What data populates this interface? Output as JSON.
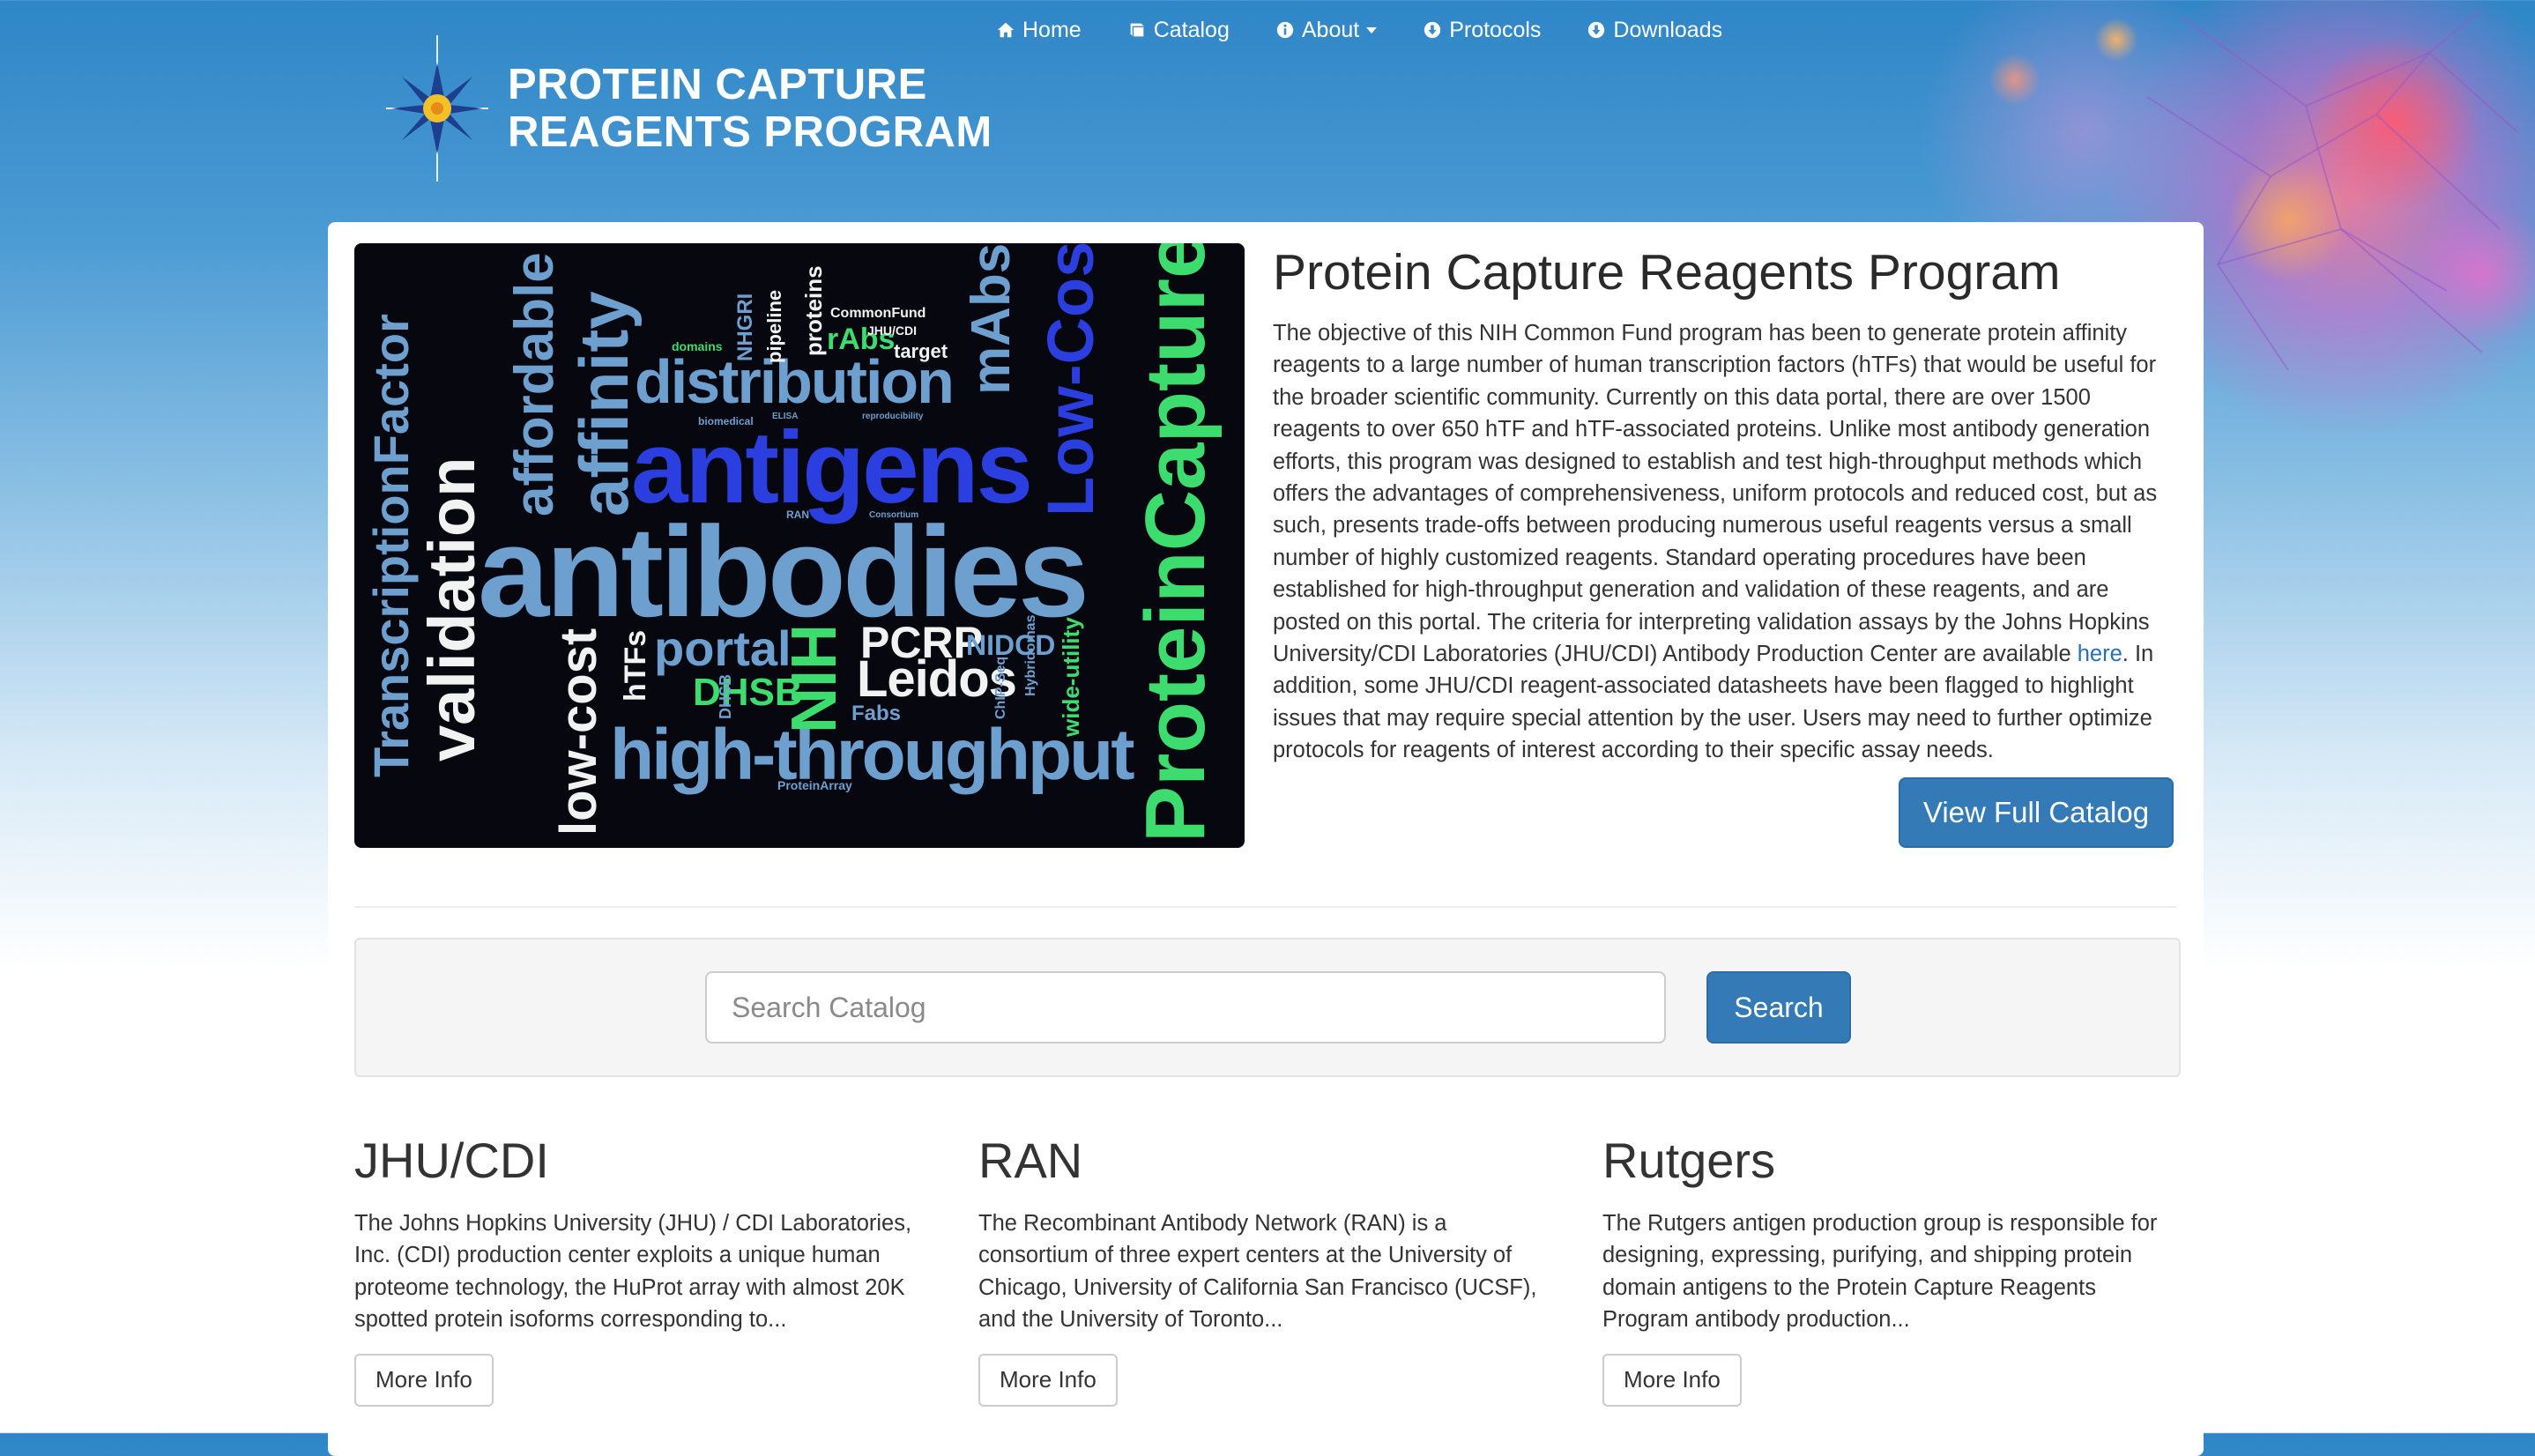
{
  "nav": {
    "items": [
      {
        "label": "Home",
        "icon": "home-icon"
      },
      {
        "label": "Catalog",
        "icon": "book-icon"
      },
      {
        "label": "About",
        "icon": "info-circle-icon"
      },
      {
        "label": "Protocols",
        "icon": "download-circle-icon"
      },
      {
        "label": "Downloads",
        "icon": "download-circle-icon"
      }
    ]
  },
  "logo": {
    "line1": "PROTEIN CAPTURE",
    "line2": "REAGENTS PROGRAM"
  },
  "intro": {
    "title": "Protein Capture Reagents Program",
    "body_before_link": "The objective of this NIH Common Fund program has been to generate protein affinity reagents to a large number of human transcription factors (hTFs) that would be useful for the broader scientific community. Currently on this data portal, there are over 1500 reagents to over 650 hTF and hTF-associated proteins. Unlike most antibody generation efforts, this program was designed to establish and test high-throughput methods which offers the advantages of comprehensiveness, uniform protocols and reduced cost, but as such, presents trade-offs between producing numerous useful reagents versus a small number of highly customized reagents. Standard operating procedures have been established for high-throughput generation and validation of these reagents, and are posted on this portal. The criteria for interpreting validation assays by the Johns Hopkins University/CDI Laboratories (JHU/CDI) Antibody Production Center are available ",
    "link_text": "here",
    "body_after_link": ". In addition, some JHU/CDI reagent-associated datasheets have been flagged to highlight issues that may require special attention by the user. Users may need to further optimize protocols for reagents of interest according to their specific assay needs.",
    "catalog_button": "View Full Catalog"
  },
  "wordcloud": {
    "words": [
      "antibodies",
      "antigens",
      "distribution",
      "affinity",
      "affordable",
      "validation",
      "TranscriptionFactor",
      "ProteinCapture",
      "Low-Cost",
      "mAbs",
      "high-throughput",
      "Leidos",
      "PCRP",
      "NIDCD",
      "NIH",
      "portal",
      "DHSB",
      "low-cost",
      "hTFs",
      "rAbs",
      "proteins",
      "pipeline",
      "NHGRI",
      "target",
      "CommonFund",
      "JHU/CDI",
      "domains",
      "Fabs",
      "wide-utility",
      "ChIP-Seq",
      "Hybridomas",
      "ProteinArray",
      "biomedical",
      "reproducibility",
      "ELISA",
      "Consortium",
      "RAN",
      "DHSB"
    ]
  },
  "search": {
    "placeholder": "Search Catalog",
    "button": "Search"
  },
  "centers": [
    {
      "title": "JHU/CDI",
      "text": "The Johns Hopkins University (JHU) / CDI Laboratories, Inc. (CDI) production center exploits a unique human proteome technology, the HuProt array with almost 20K spotted protein isoforms corresponding to...",
      "button": "More Info"
    },
    {
      "title": "RAN",
      "text": "The Recombinant Antibody Network (RAN) is a consortium of three expert centers at the University of Chicago, University of California San Francisco (UCSF), and the University of Toronto...",
      "button": "More Info"
    },
    {
      "title": "Rutgers",
      "text": "The Rutgers antigen production group is responsible for designing, expressing, purifying, and shipping protein domain antigens to the Protein Capture Reagents Program antibody production...",
      "button": "More Info"
    }
  ],
  "colors": {
    "brand_blue": "#337ab7",
    "link": "#2a6fb0",
    "wc_light_blue": "#6d9fcf",
    "wc_blue": "#2b3fe0",
    "wc_green": "#3ddc6e",
    "wc_white": "#f2f2f2"
  }
}
